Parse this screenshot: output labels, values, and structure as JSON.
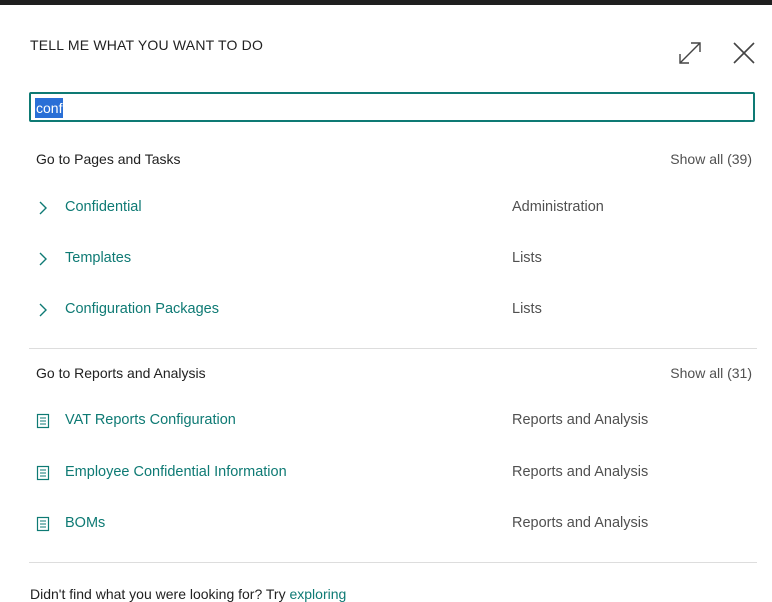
{
  "dialog": {
    "title": "TELL ME WHAT YOU WANT TO DO",
    "expand_icon": "expand-icon",
    "close_icon": "close-icon"
  },
  "search": {
    "value": "conf"
  },
  "pages_group": {
    "title": "Go to Pages and Tasks",
    "show_all": "Show all (39)",
    "items": [
      {
        "label": "Confidential",
        "category": "Administration",
        "icon": "chevron-right-icon"
      },
      {
        "label": "Templates",
        "category": "Lists",
        "icon": "chevron-right-icon"
      },
      {
        "label": "Configuration Packages",
        "category": "Lists",
        "icon": "chevron-right-icon"
      }
    ]
  },
  "reports_group": {
    "title": "Go to Reports and Analysis",
    "show_all": "Show all (31)",
    "items": [
      {
        "label": "VAT Reports Configuration",
        "category": "Reports and Analysis",
        "icon": "report-icon"
      },
      {
        "label": "Employee Confidential Information",
        "category": "Reports and Analysis",
        "icon": "report-icon"
      },
      {
        "label": "BOMs",
        "category": "Reports and Analysis",
        "icon": "report-icon"
      }
    ]
  },
  "footer": {
    "text": "Didn't find what you were looking for? Try ",
    "link": "exploring"
  },
  "colors": {
    "accent": "#0e7a74",
    "selection": "#2a6fd6",
    "muted": "#505050"
  }
}
